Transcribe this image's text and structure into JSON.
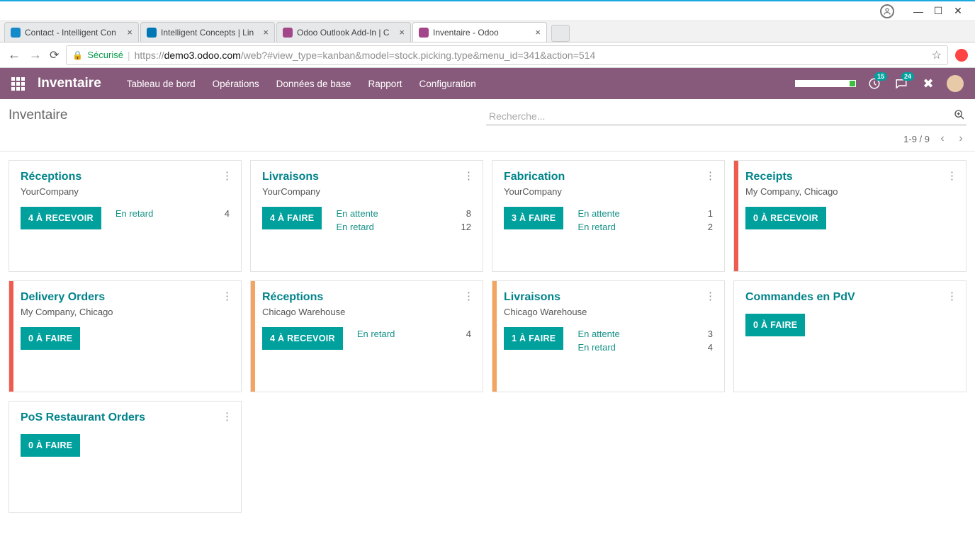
{
  "window": {
    "user_icon": "◯"
  },
  "tabs": [
    {
      "title": "Contact - Intelligent Con",
      "fav": "#1489c9"
    },
    {
      "title": "Intelligent Concepts | Lin",
      "fav": "#0077b5"
    },
    {
      "title": "Odoo Outlook Add-In | C",
      "fav": "#a24689"
    },
    {
      "title": "Inventaire - Odoo",
      "fav": "#a24689",
      "active": true
    }
  ],
  "address": {
    "secure_label": "Sécurisé",
    "url_prefix": "https://",
    "url_host": "demo3.odoo.com",
    "url_rest": "/web?#view_type=kanban&model=stock.picking.type&menu_id=341&action=514"
  },
  "nav": {
    "app_title": "Inventaire",
    "menu": [
      "Tableau de bord",
      "Opérations",
      "Données de base",
      "Rapport",
      "Configuration"
    ],
    "badge1": "15",
    "badge2": "24"
  },
  "control": {
    "breadcrumb": "Inventaire",
    "search_placeholder": "Recherche...",
    "pager": "1-9 / 9"
  },
  "cards": [
    {
      "title": "Réceptions",
      "sub": "YourCompany",
      "btn": "4 À RECEVOIR",
      "hl": "",
      "stats": [
        {
          "lbl": "En retard",
          "val": "4"
        }
      ]
    },
    {
      "title": "Livraisons",
      "sub": "YourCompany",
      "btn": "4 À FAIRE",
      "hl": "",
      "stats": [
        {
          "lbl": "En attente",
          "val": "8"
        },
        {
          "lbl": "En retard",
          "val": "12"
        }
      ]
    },
    {
      "title": "Fabrication",
      "sub": "YourCompany",
      "btn": "3 À FAIRE",
      "hl": "",
      "stats": [
        {
          "lbl": "En attente",
          "val": "1"
        },
        {
          "lbl": "En retard",
          "val": "2"
        }
      ]
    },
    {
      "title": "Receipts",
      "sub": "My Company, Chicago",
      "btn": "0 À RECEVOIR",
      "hl": "red",
      "stats": []
    },
    {
      "title": "Delivery Orders",
      "sub": "My Company, Chicago",
      "btn": "0 À FAIRE",
      "hl": "red",
      "stats": []
    },
    {
      "title": "Réceptions",
      "sub": "Chicago Warehouse",
      "btn": "4 À RECEVOIR",
      "hl": "orange",
      "stats": [
        {
          "lbl": "En retard",
          "val": "4"
        }
      ]
    },
    {
      "title": "Livraisons",
      "sub": "Chicago Warehouse",
      "btn": "1 À FAIRE",
      "hl": "orange",
      "stats": [
        {
          "lbl": "En attente",
          "val": "3"
        },
        {
          "lbl": "En retard",
          "val": "4"
        }
      ]
    },
    {
      "title": "Commandes en PdV",
      "sub": "",
      "btn": "0 À FAIRE",
      "hl": "",
      "stats": []
    },
    {
      "title": "PoS Restaurant Orders",
      "sub": "",
      "btn": "0 À FAIRE",
      "hl": "",
      "stats": []
    }
  ]
}
